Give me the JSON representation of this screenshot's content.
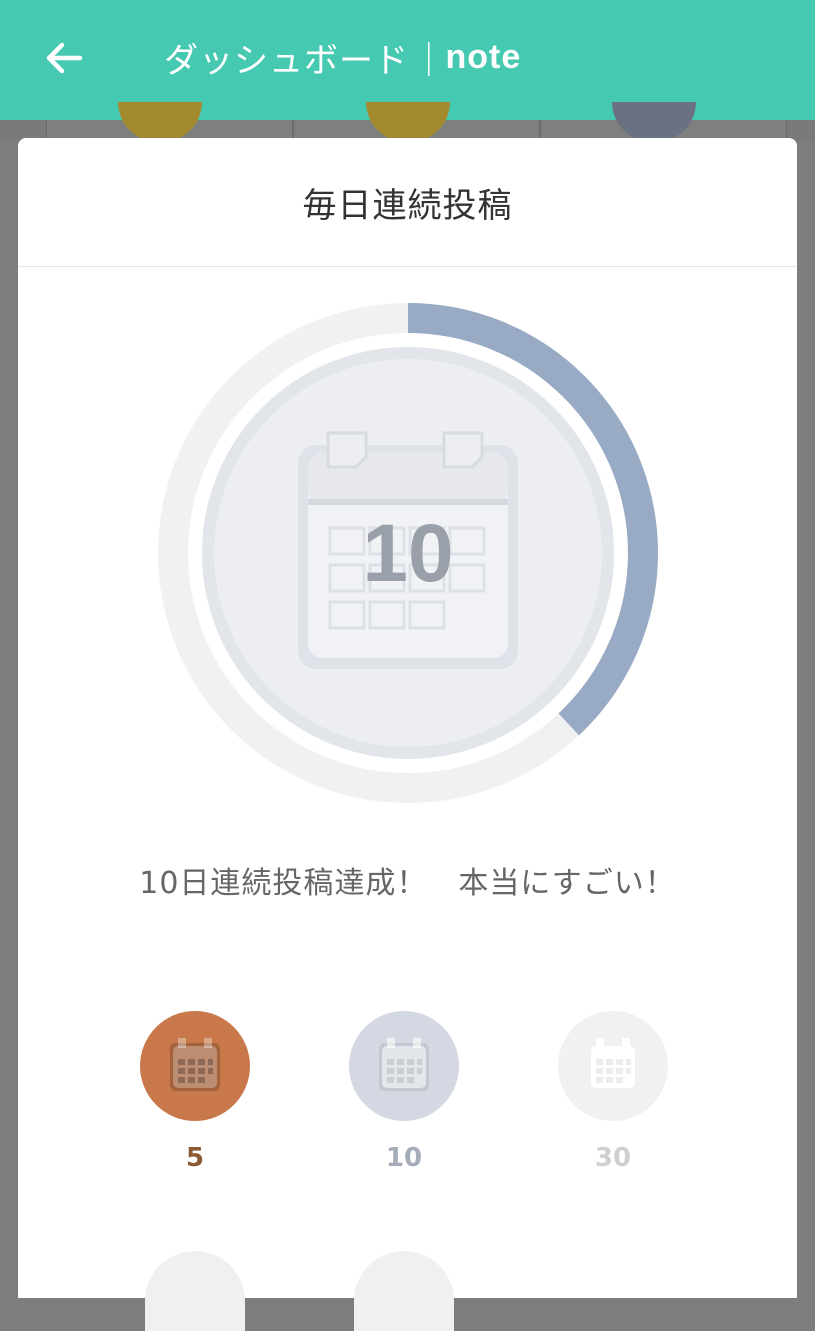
{
  "header": {
    "back_icon": "arrow-left-icon",
    "title": "ダッシュボード",
    "separator": "|",
    "brand": "note"
  },
  "modal": {
    "title": "毎日連続投稿",
    "progress_fraction": 0.38,
    "badge_number": "10",
    "message": "10日連続投稿達成！　本当にすごい！"
  },
  "badges": [
    {
      "label": "5",
      "state": "earned",
      "color": "#c8784a",
      "label_color": "#8a5a35"
    },
    {
      "label": "10",
      "state": "earned",
      "color": "#d3d8e2",
      "label_color": "#a4acb8"
    },
    {
      "label": "30",
      "state": "locked",
      "color": "#f1f1f1",
      "label_color": "#cfcfcf"
    }
  ],
  "colors": {
    "header_bg": "#45c9b1",
    "progress": "#98aac4",
    "track": "#f0f1f2"
  }
}
